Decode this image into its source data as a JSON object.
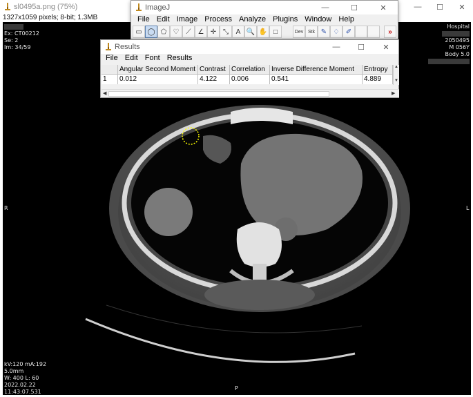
{
  "image_window": {
    "title": "sl0495a.png (75%)",
    "info": "1327x1059 pixels; 8-bit; 1.3MB",
    "overlay": {
      "top_left": [
        "Ex: CT00212",
        "Se: 2",
        "Im: 34/59"
      ],
      "top_right": [
        "Hospital",
        "2050495",
        "M 056Y",
        "Body 5.0"
      ],
      "bottom_left": [
        "kV:120 mA:192",
        "5.0mm",
        "W: 400 L: 60",
        "2022.02.22",
        "11:43:07.531"
      ],
      "left_marker": "R",
      "right_marker": "L",
      "bottom_marker": "P"
    }
  },
  "imagej": {
    "title": "ImageJ",
    "menu": [
      "File",
      "Edit",
      "Image",
      "Process",
      "Analyze",
      "Plugins",
      "Window",
      "Help"
    ],
    "tools": [
      {
        "name": "rectangle-tool",
        "glyph": "▭"
      },
      {
        "name": "oval-tool",
        "glyph": "◯"
      },
      {
        "name": "polygon-tool",
        "glyph": "⬠"
      },
      {
        "name": "freehand-tool",
        "glyph": "♡"
      },
      {
        "name": "line-tool",
        "glyph": "⟋"
      },
      {
        "name": "angle-tool",
        "glyph": "∠"
      },
      {
        "name": "point-tool",
        "glyph": "✛"
      },
      {
        "name": "wand-tool",
        "glyph": "⤡"
      },
      {
        "name": "text-tool",
        "glyph": "A"
      },
      {
        "name": "magnifier-tool",
        "glyph": "🔍"
      },
      {
        "name": "scroll-tool",
        "glyph": "✋"
      },
      {
        "name": "color-picker-tool",
        "glyph": "□"
      },
      {
        "name": "developer-menu-tool",
        "glyph": "Dev"
      },
      {
        "name": "stacks-menu-tool",
        "glyph": "Stk"
      },
      {
        "name": "brush-tool",
        "glyph": "✎"
      },
      {
        "name": "dropper-tool",
        "glyph": "♢"
      },
      {
        "name": "pencil-tool",
        "glyph": "✐"
      },
      {
        "name": "more-tools",
        "glyph": "»"
      }
    ]
  },
  "results": {
    "title": "Results",
    "menu": [
      "File",
      "Edit",
      "Font",
      "Results"
    ],
    "columns": [
      "",
      "Angular Second Moment",
      "Contrast",
      "Correlation",
      "Inverse Difference Moment",
      "Entropy"
    ],
    "rows": [
      [
        "1",
        "0.012",
        "4.122",
        "0.006",
        "0.541",
        "4.889"
      ]
    ]
  },
  "colors": {
    "ct_background": "#000000",
    "roi_yellow": "#ffff00",
    "active_tool": "#c9dcf3",
    "more_tools_red": "#c00000"
  }
}
